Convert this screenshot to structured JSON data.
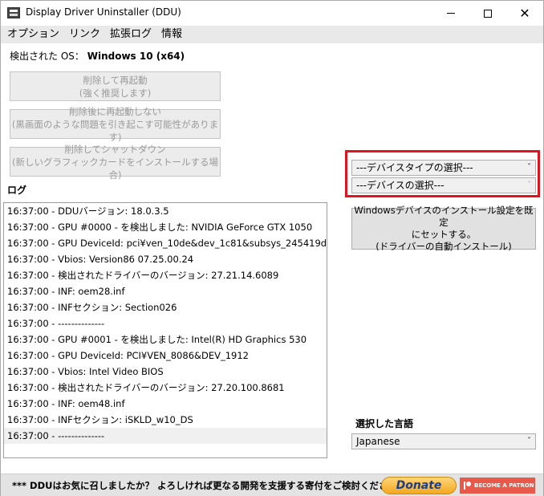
{
  "window": {
    "title": "Display Driver Uninstaller (DDU)",
    "minimize_label": "",
    "maximize_label": "",
    "close_label": "✕"
  },
  "menu": [
    {
      "label": "オプション"
    },
    {
      "label": "リンク"
    },
    {
      "label": "拡張ログ"
    },
    {
      "label": "情報"
    }
  ],
  "os": {
    "label": "検出された OS：",
    "value": "Windows 10 (x64)"
  },
  "actions": [
    {
      "line1": "削除して再起動",
      "line2": "(強く推奨します)"
    },
    {
      "line1": "削除後に再起動しない",
      "line2": "(黒画面のような問題を引き起こす可能性があります)"
    },
    {
      "line1": "削除してシャットダウン",
      "line2": "(新しいグラフィックカードをインストールする場合)"
    }
  ],
  "log": {
    "label": "ログ",
    "rows": [
      "16:37:00 - DDUバージョン: 18.0.3.5",
      "16:37:00 - GPU #0000 - を検出しました: NVIDIA GeForce GTX 1050",
      "16:37:00 - GPU DeviceId: pci¥ven_10de&dev_1c81&subsys_245419da",
      "16:37:00 - Vbios: Version86 07.25.00.24",
      "16:37:00 - 検出されたドライバーのバージョン: 27.21.14.6089",
      "16:37:00 - INF: oem28.inf",
      "16:37:00 - INFセクション: Section026",
      "16:37:00 - --------------",
      "16:37:00 - GPU #0001 - を検出しました: Intel(R) HD Graphics 530",
      "16:37:00 - GPU DeviceId: PCI¥VEN_8086&DEV_1912",
      "16:37:00 - Vbios: Intel Video BIOS",
      "16:37:00 - 検出されたドライバーのバージョン: 27.20.100.8681",
      "16:37:00 - INF: oem48.inf",
      "16:37:00 - INFセクション: iSKLD_w10_DS",
      "16:37:00 - --------------"
    ]
  },
  "device_type_select": {
    "value": "---デバイスタイプの選択---",
    "arrow": "˅"
  },
  "device_select": {
    "value": "---デバイスの選択---",
    "arrow": "˅"
  },
  "windows_install_button": {
    "line1": "Windowsデバイスのインストール設定を既定",
    "line2": "にセットする。",
    "line3": "(ドライバーの自動インストール)"
  },
  "language": {
    "label": "選択した言語",
    "value": "Japanese",
    "arrow": "˅"
  },
  "footer": {
    "text": "*** DDUはお気に召しましたか？ よろしければ更なる開発を支援する寄付をご検討ください。***",
    "donate_label": "Donate",
    "patron_label": "BECOME A PATRON"
  }
}
